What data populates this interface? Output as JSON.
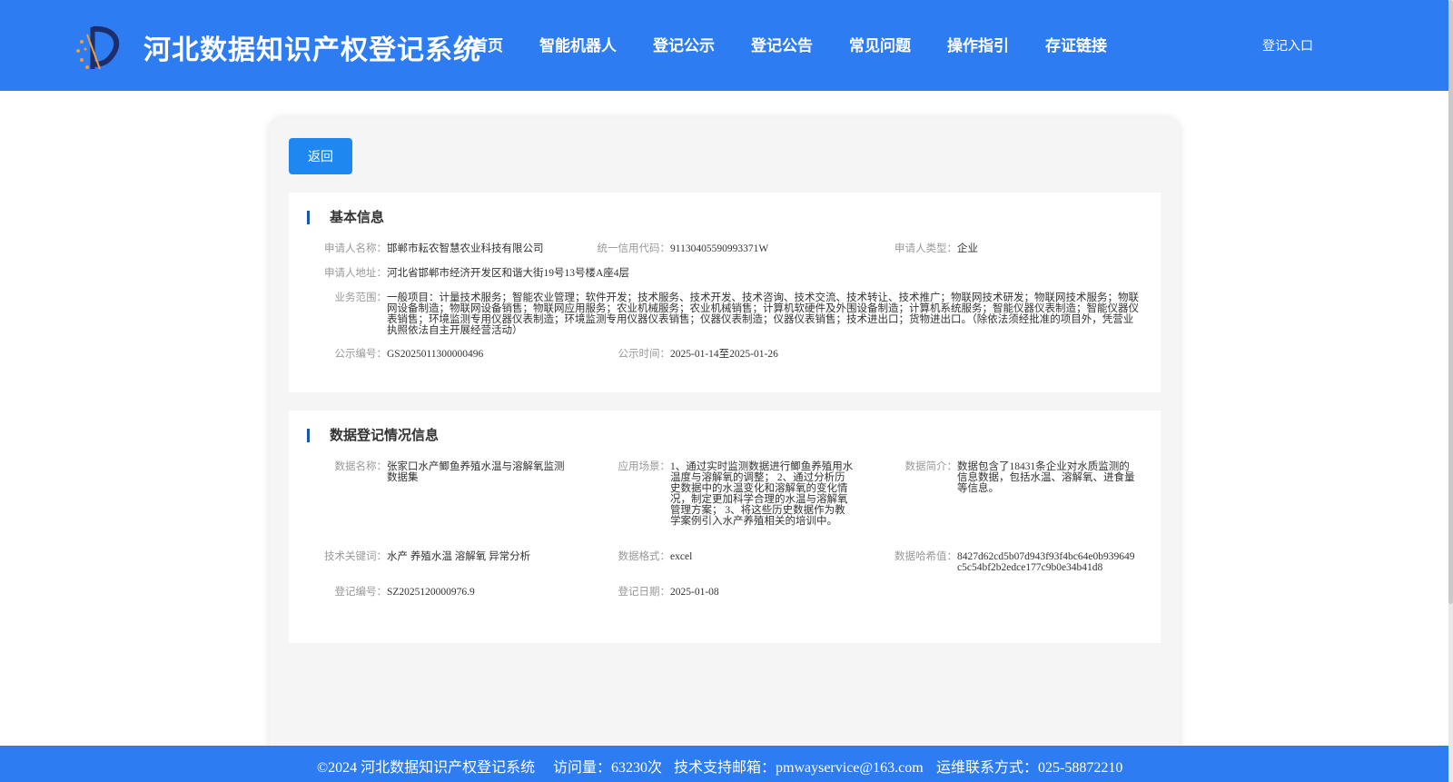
{
  "header": {
    "site_title": "河北数据知识产权登记系统",
    "nav": [
      "首页",
      "智能机器人",
      "登记公示",
      "登记公告",
      "常见问题",
      "操作指引",
      "存证链接"
    ],
    "login_label": "登记入口",
    "accent_color": "#2d7cf2"
  },
  "back_label": "返回",
  "basic": {
    "title": "基本信息",
    "applicant_name": {
      "label": "申请人名称：",
      "value": "邯郸市耘农智慧农业科技有限公司"
    },
    "credit_code": {
      "label": "统一信用代码：",
      "value": "91130405590993371W"
    },
    "applicant_type": {
      "label": "申请人类型：",
      "value": "企业"
    },
    "address": {
      "label": "申请人地址：",
      "value": "河北省邯郸市经济开发区和谐大街19号13号楼A座4层"
    },
    "scope": {
      "label": "业务范围：",
      "value": "一般项目：计量技术服务；智能农业管理；软件开发；技术服务、技术开发、技术咨询、技术交流、技术转让、技术推广；物联网技术研发；物联网技术服务；物联网设备制造；物联网设备销售；物联网应用服务；农业机械服务；农业机械销售；计算机软硬件及外围设备制造；计算机系统服务；智能仪器仪表制造；智能仪器仪表销售；环境监测专用仪器仪表制造；环境监测专用仪器仪表销售；仪器仪表制造；仪器仪表销售；技术进出口；货物进出口。（除依法须经批准的项目外，凭营业执照依法自主开展经营活动）"
    },
    "notice_no": {
      "label": "公示编号：",
      "value": "GS2025011300000496"
    },
    "notice_time": {
      "label": "公示时间：",
      "value": "2025-01-14至2025-01-26"
    }
  },
  "registration": {
    "title": "数据登记情况信息",
    "data_name": {
      "label": "数据名称：",
      "value": "张家口水产鲫鱼养殖水温与溶解氧监测数据集"
    },
    "scenario": {
      "label": "应用场景：",
      "value": "1、通过实时监测数据进行鲫鱼养殖用水温度与溶解氧的调整； 2、通过分析历史数据中的水温变化和溶解氧的变化情况，制定更加科学合理的水温与溶解氧管理方案； 3、将这些历史数据作为教学案例引入水产养殖相关的培训中。"
    },
    "summary": {
      "label": "数据简介：",
      "value": "数据包含了18431条企业对水质监测的信息数据，包括水温、溶解氧、进食量等信息。"
    },
    "keywords": {
      "label": "技术关键词：",
      "value": "水产 养殖水温 溶解氧 异常分析"
    },
    "format": {
      "label": "数据格式：",
      "value": "excel"
    },
    "hash": {
      "label": "数据哈希值：",
      "value": "8427d62cd5b07d943f93f4bc64e0b939649c5c54bf2b2edce177c9b0e34b41d8"
    },
    "reg_no": {
      "label": "登记编号：",
      "value": "SZ2025120000976.9"
    },
    "reg_date": {
      "label": "登记日期：",
      "value": "2025-01-08"
    }
  },
  "footer": {
    "copyright": "©2024 河北数据知识产权登记系统",
    "visits": "访问量：63230次",
    "email": "技术支持邮箱：pmwayservice@163.com",
    "phone": "运维联系方式：025-58872210"
  }
}
